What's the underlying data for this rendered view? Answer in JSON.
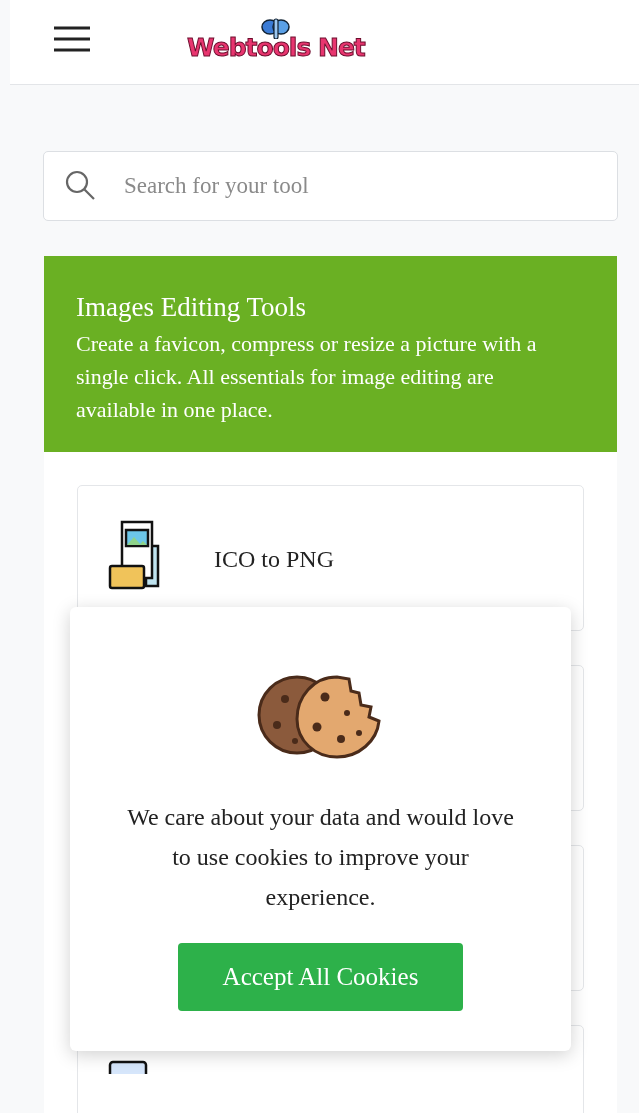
{
  "header": {
    "logo_text": "Webtools Net"
  },
  "search": {
    "placeholder": "Search for your tool"
  },
  "category": {
    "title": "Images Editing Tools",
    "description": "Create a favicon, compress or resize a picture with a single click. All essentials for image editing are available in one place."
  },
  "tools": [
    {
      "title": "ICO to PNG"
    }
  ],
  "cookie_popup": {
    "message": "We care about your data and would love to use cookies to improve your experience.",
    "button": "Accept All Cookies"
  }
}
